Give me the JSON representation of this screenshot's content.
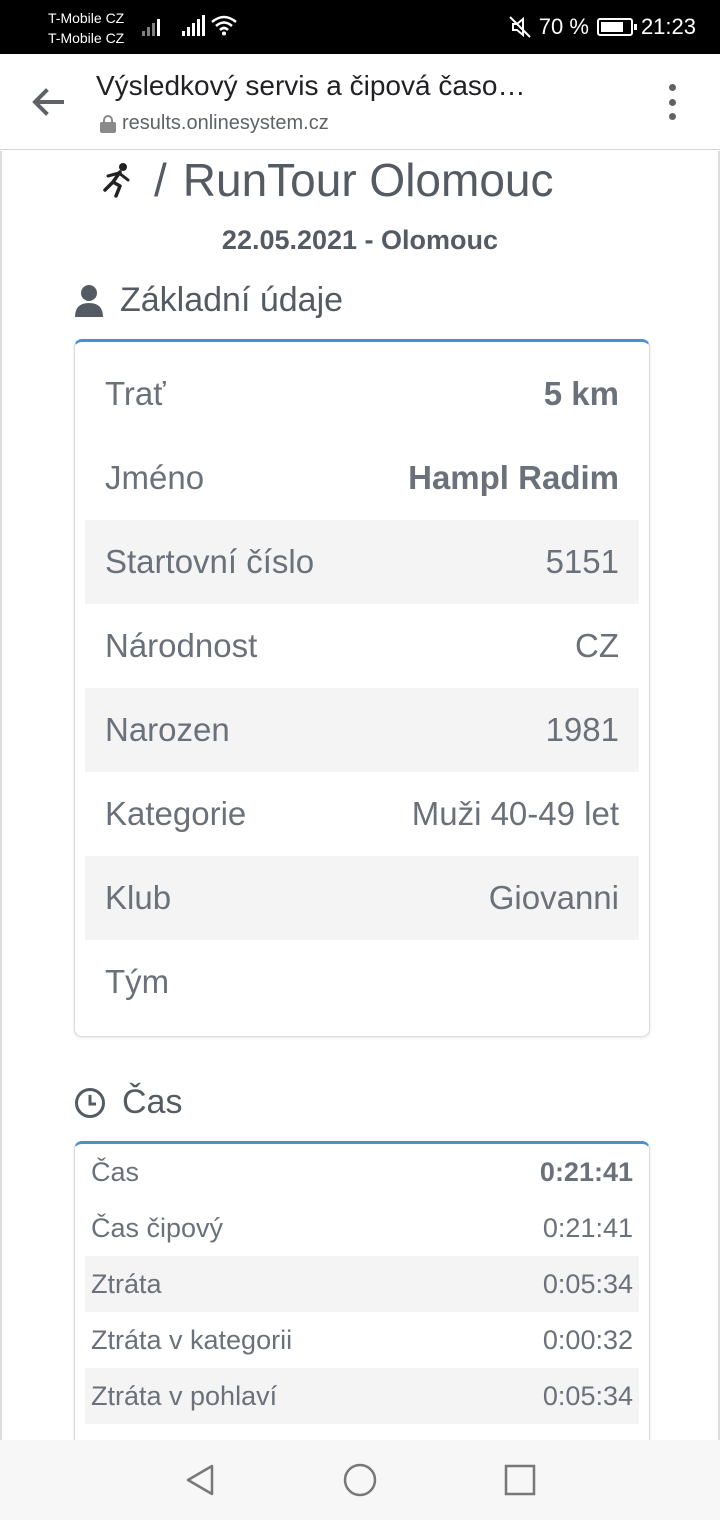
{
  "status_bar": {
    "carrier1": "T-Mobile CZ",
    "carrier2": "T-Mobile CZ",
    "battery_text": "70 %",
    "time": "21:23"
  },
  "browser": {
    "title": "Výsledkový servis a čipová časo…",
    "url": "results.onlinesystem.cz"
  },
  "event": {
    "name": "RunTour Olomouc",
    "separator": "/",
    "date_place": "22.05.2021 - Olomouc"
  },
  "basic": {
    "heading": "Základní údaje",
    "rows": [
      {
        "label": "Trať",
        "value": "5 km"
      },
      {
        "label": "Jméno",
        "value": "Hampl Radim"
      },
      {
        "label": "Startovní číslo",
        "value": "5151"
      },
      {
        "label": "Národnost",
        "value": "CZ"
      },
      {
        "label": "Narozen",
        "value": "1981"
      },
      {
        "label": "Kategorie",
        "value": "Muži 40-49 let"
      },
      {
        "label": "Klub",
        "value": "Giovanni"
      },
      {
        "label": "Tým",
        "value": ""
      }
    ]
  },
  "time": {
    "heading": "Čas",
    "rows": [
      {
        "label": "Čas",
        "value": "0:21:41"
      },
      {
        "label": "Čas čipový",
        "value": "0:21:41"
      },
      {
        "label": "Ztráta",
        "value": "0:05:34"
      },
      {
        "label": "Ztráta v kategorii",
        "value": "0:00:32"
      },
      {
        "label": "Ztráta v pohlaví",
        "value": "0:05:34"
      }
    ]
  },
  "colors": {
    "accent": "#4a8fd0",
    "text": "#6b717a",
    "heading": "#555b63"
  }
}
